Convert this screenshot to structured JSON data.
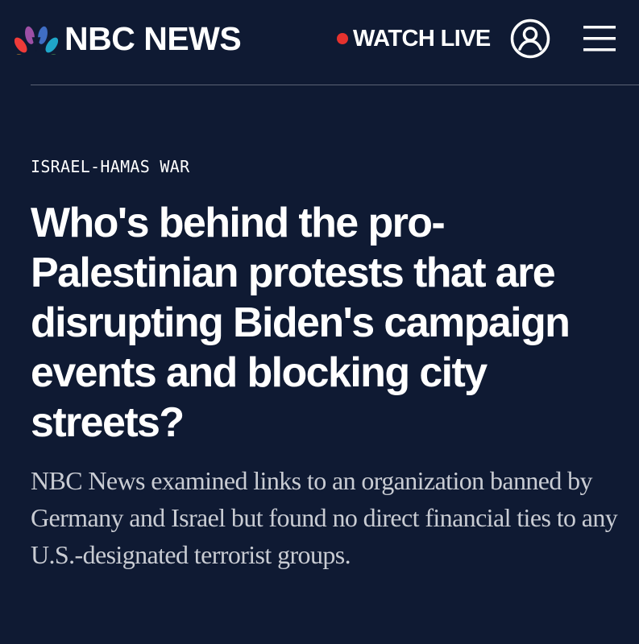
{
  "header": {
    "logo_text": "NBC NEWS",
    "watch_live_label": "WATCH LIVE",
    "live_dot_color": "#e5322e",
    "icons": {
      "logo": "nbc-peacock-icon",
      "account": "user-circle-icon",
      "menu": "hamburger-menu-icon"
    }
  },
  "article": {
    "section_label": "ISRAEL-HAMAS WAR",
    "headline": "Who's behind the pro-Palestinian protests that are disrupting Biden's campaign events and blocking city streets?",
    "dek": "NBC News examined links to an organization banned by Germany and Israel but found no direct financial ties to any U.S.-designated terrorist groups."
  },
  "theme": {
    "background": "#0f1a33",
    "text": "#ffffff",
    "dek_text": "#c9ccd3",
    "peacock_colors": [
      "#f5a623",
      "#ef3b39",
      "#9e4fa5",
      "#3f6dc4",
      "#1fa6c9",
      "#5cb85c"
    ]
  }
}
